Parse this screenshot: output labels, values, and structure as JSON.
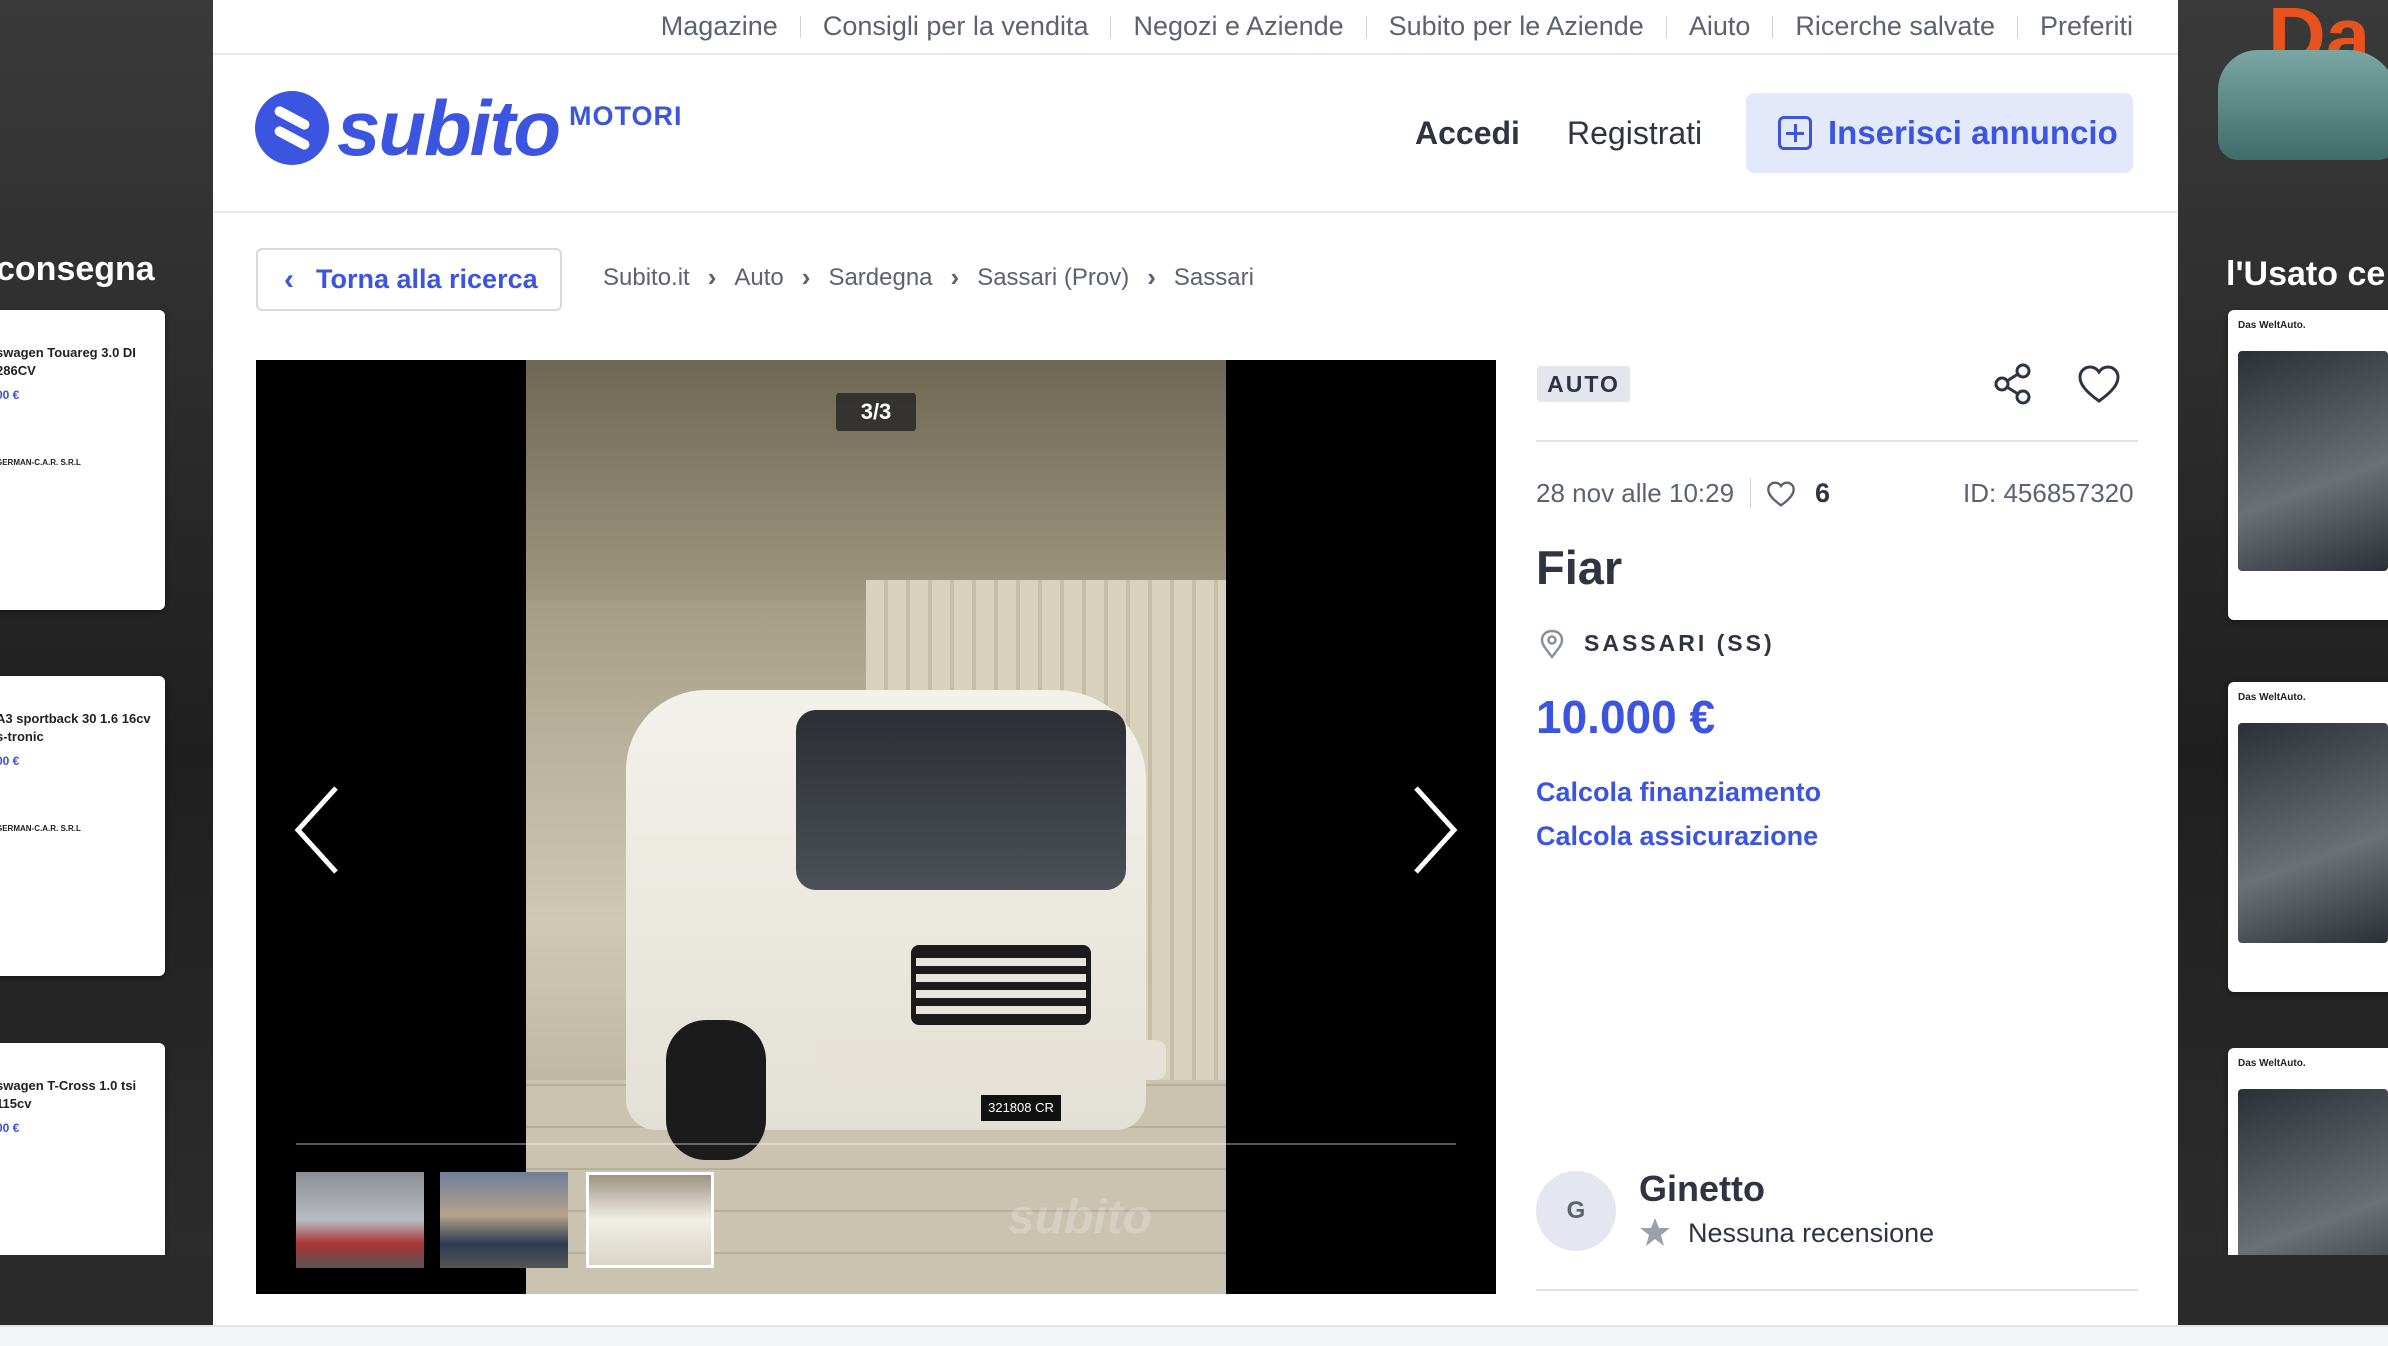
{
  "top_nav": {
    "items": [
      "Magazine",
      "Consigli per la vendita",
      "Negozi e Aziende",
      "Subito per le Aziende",
      "Aiuto",
      "Ricerche salvate",
      "Preferiti"
    ]
  },
  "header": {
    "logo_word": "subito",
    "logo_sub": "MOTORI",
    "login": "Accedi",
    "register": "Registrati",
    "insert_ad": "Inserisci annuncio"
  },
  "breadcrumb": {
    "back": "Torna alla ricerca",
    "items": [
      "Subito.it",
      "Auto",
      "Sardegna",
      "Sassari (Prov)",
      "Sassari"
    ]
  },
  "gallery": {
    "counter": "3/3",
    "watermark": "subito",
    "plate": "321808 CR"
  },
  "listing": {
    "category": "AUTO",
    "date": "28 nov alle 10:29",
    "likes": "6",
    "id": "ID: 456857320",
    "title": "Fiar",
    "location": "SASSARI (SS)",
    "price": "10.000 €",
    "link_financing": "Calcola finanziamento",
    "link_insurance": "Calcola assicurazione"
  },
  "seller": {
    "initial": "G",
    "name": "Ginetto",
    "reviews": "Nessuna recensione"
  },
  "ads": {
    "left_headline": "consegna",
    "left_cards": [
      {
        "title": "swagen Touareg 3.0 DI 286CV",
        "price": "00 €",
        "azienda": "GERMAN-C.A.R. S.R.L"
      },
      {
        "title": "A3 sportback 30 1.6 16cv s-tronic",
        "price": "00 €",
        "azienda": "GERMAN-C.A.R. S.R.L"
      },
      {
        "title": "swagen T-Cross 1.0 tsi 115cv",
        "price": "00 €",
        "azienda": ""
      }
    ],
    "right_headline": "l'Usato ce",
    "right_brand": "Da",
    "right_cards": [
      {
        "brand": "Das WeltAuto."
      },
      {
        "brand": "Das WeltAuto."
      },
      {
        "brand": "Das WeltAuto."
      }
    ]
  },
  "colors": {
    "accent": "#3c55e0",
    "text": "#2f3443",
    "muted": "#5d6270"
  }
}
